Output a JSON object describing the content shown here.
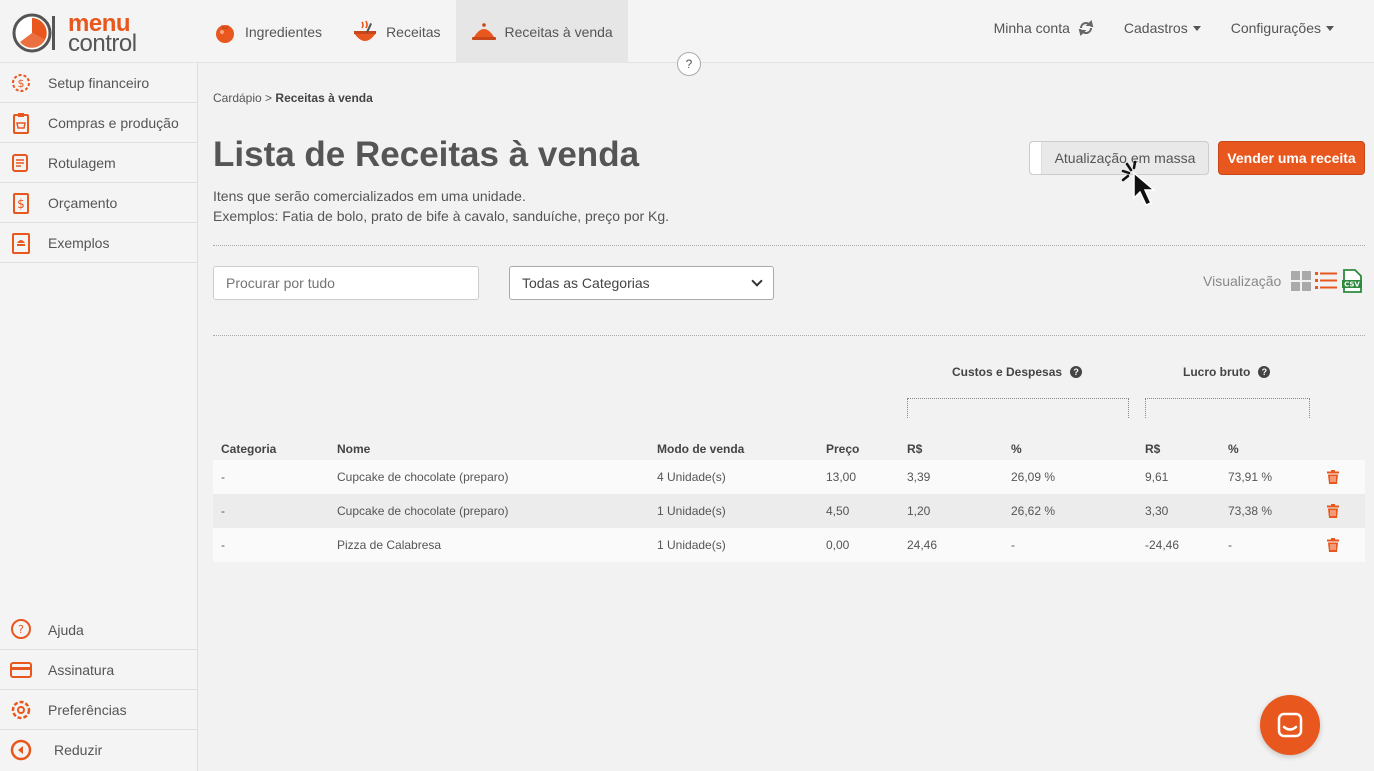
{
  "brand": {
    "word1": "menu",
    "word2": "control",
    "accent": "#e8571e"
  },
  "topnav": {
    "tabs": [
      {
        "label": "Ingredientes",
        "icon": "tomato-icon"
      },
      {
        "label": "Receitas",
        "icon": "pot-icon"
      },
      {
        "label": "Receitas à venda",
        "icon": "cloche-icon",
        "active": true
      }
    ],
    "right": {
      "account": "Minha conta",
      "cadastros": "Cadastros",
      "config": "Configurações"
    },
    "help": "?"
  },
  "sidebar": {
    "items": [
      {
        "label": "Setup financeiro",
        "icon": "money-gear-icon"
      },
      {
        "label": "Compras e produção",
        "icon": "shopping-list-icon"
      },
      {
        "label": "Rotulagem",
        "icon": "label-icon"
      },
      {
        "label": "Orçamento",
        "icon": "budget-icon"
      },
      {
        "label": "Exemplos",
        "icon": "recipe-book-icon"
      }
    ],
    "bottom": [
      {
        "label": "Ajuda",
        "icon": "help-icon"
      },
      {
        "label": "Assinatura",
        "icon": "credit-card-icon"
      },
      {
        "label": "Preferências",
        "icon": "gear-icon"
      },
      {
        "label": "Reduzir",
        "icon": "collapse-left-icon"
      }
    ]
  },
  "main": {
    "breadcrumb": {
      "parent": "Cardápio",
      "sep": ">",
      "current": "Receitas à venda"
    },
    "title": "Lista de Receitas à venda",
    "subtitle_line1": "Itens que serão comercializados em uma unidade.",
    "subtitle_line2": "Exemplos: Fatia de bolo, prato de bife à cavalo, sanduíche, preço por Kg.",
    "mass_update": "Atualização em massa",
    "sell_button": "Vender uma receita",
    "search_placeholder": "Procurar por tudo",
    "category_select": "Todas as Categorias",
    "visualization_label": "Visualização",
    "csv_label": "CSV"
  },
  "table": {
    "group_costs": "Custos e Despesas",
    "group_profit": "Lucro bruto",
    "headers": {
      "categoria": "Categoria",
      "nome": "Nome",
      "modo": "Modo de venda",
      "preco": "Preço",
      "custo_rs": "R$",
      "custo_pct": "%",
      "lucro_rs": "R$",
      "lucro_pct": "%"
    },
    "rows": [
      {
        "categoria": "-",
        "nome": "Cupcake de chocolate (preparo)",
        "modo": "4 Unidade(s)",
        "preco": "13,00",
        "custo_rs": "3,39",
        "custo_pct": "26,09 %",
        "lucro_rs": "9,61",
        "lucro_pct": "73,91 %"
      },
      {
        "categoria": "-",
        "nome": "Cupcake de chocolate (preparo)",
        "modo": "1 Unidade(s)",
        "preco": "4,50",
        "custo_rs": "1,20",
        "custo_pct": "26,62 %",
        "lucro_rs": "3,30",
        "lucro_pct": "73,38 %"
      },
      {
        "categoria": "-",
        "nome": "Pizza de Calabresa",
        "modo": "1 Unidade(s)",
        "preco": "0,00",
        "custo_rs": "24,46",
        "custo_pct": "-",
        "lucro_rs": "-24,46",
        "lucro_pct": "-"
      }
    ]
  }
}
